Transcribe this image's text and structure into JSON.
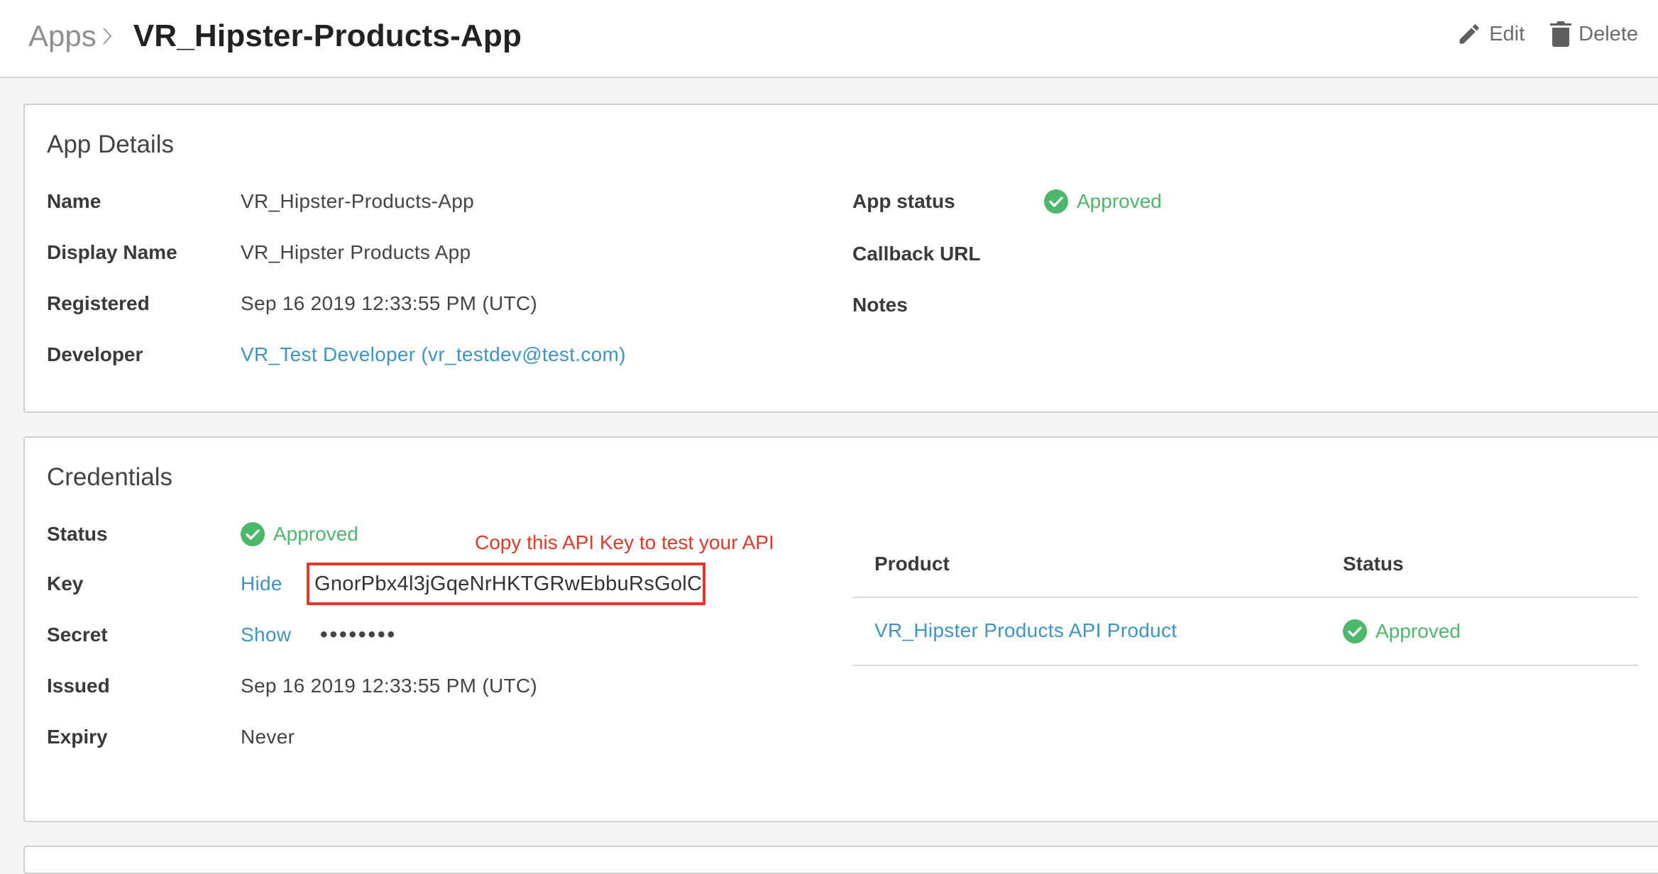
{
  "header": {
    "breadcrumb_root": "Apps",
    "title": "VR_Hipster-Products-App",
    "edit_label": "Edit",
    "delete_label": "Delete",
    "icons": {
      "separator": "chevron-right-icon",
      "edit": "pencil-icon",
      "delete": "trash-icon"
    }
  },
  "app_details": {
    "title": "App Details",
    "fields": [
      {
        "label": "Name",
        "value": "VR_Hipster-Products-App"
      },
      {
        "label": "Display Name",
        "value": "VR_Hipster Products App"
      },
      {
        "label": "Registered",
        "value": "Sep 16 2019 12:33:55 PM (UTC)"
      },
      {
        "label": "Developer",
        "value": "VR_Test Developer (vr_testdev@test.com)"
      }
    ],
    "right_fields": [
      {
        "label": "App status",
        "value": "Approved"
      },
      {
        "label": "Callback URL",
        "value": ""
      },
      {
        "label": "Notes",
        "value": ""
      }
    ]
  },
  "credentials": {
    "title": "Credentials",
    "annotation": "Copy this API Key to test your API",
    "status": {
      "label": "Status",
      "value": "Approved"
    },
    "key": {
      "label": "Key",
      "toggle": "Hide",
      "value": "GnorPbx4l3jGqeNrHKTGRwEbbuRsGolC"
    },
    "secret": {
      "label": "Secret",
      "toggle": "Show",
      "value": "••••••••"
    },
    "issued": {
      "label": "Issued",
      "value": "Sep 16 2019 12:33:55 PM (UTC)"
    },
    "expiry": {
      "label": "Expiry",
      "value": "Never"
    },
    "products_table": {
      "columns": [
        "Product",
        "Status"
      ],
      "rows": [
        {
          "product": "VR_Hipster Products API Product",
          "status": "Approved"
        }
      ]
    }
  },
  "colors": {
    "link": "#3c95c9",
    "approved": "#4cb86a",
    "annotation": "#e03a26",
    "muted_text": "#8f8f8f",
    "card_border": "#cfcfcf"
  }
}
